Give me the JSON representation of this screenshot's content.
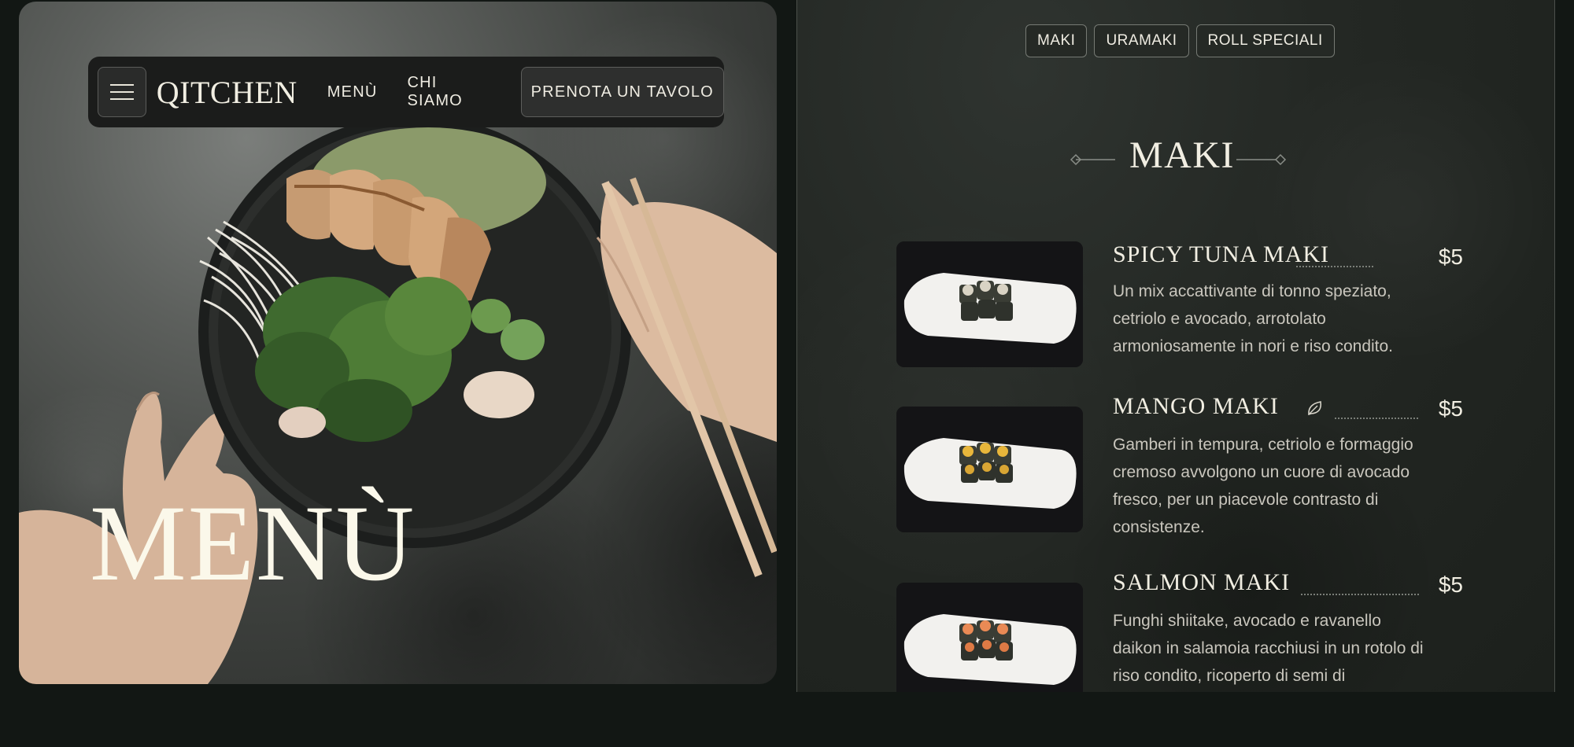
{
  "navbar": {
    "logo": "QITCHEN",
    "menu_link": "MENÙ",
    "about_link": "CHI SIAMO",
    "reserve_button": "PRENOTA UN TAVOLO"
  },
  "hero": {
    "title": "MENÙ"
  },
  "tabs": [
    {
      "label": "MAKI"
    },
    {
      "label": "URAMAKI"
    },
    {
      "label": "ROLL SPECIALI"
    }
  ],
  "section": {
    "title": "MAKI"
  },
  "items": [
    {
      "name": "SPICY TUNA MAKI",
      "price": "$5",
      "description": "Un mix accattivante di tonno speziato, cetriolo e avocado, arrotolato armoniosamente in nori e riso condito.",
      "vegetarian": false,
      "filling": "tuna"
    },
    {
      "name": "MANGO MAKI",
      "price": "$5",
      "description": "Gamberi in tempura, cetriolo e formaggio cremoso avvolgono un cuore di avocado fresco, per un piacevole contrasto di consistenze.",
      "vegetarian": true,
      "filling": "mango"
    },
    {
      "name": "SALMON MAKI",
      "price": "$5",
      "description": "Funghi shiitake, avocado e ravanello daikon in salamoia racchiusi in un rotolo di riso condito, ricoperto di semi di",
      "vegetarian": false,
      "filling": "salmon"
    }
  ],
  "colors": {
    "background": "#121714",
    "panel": "#242824",
    "text": "#f1eee2",
    "muted": "#c9c6bd"
  }
}
